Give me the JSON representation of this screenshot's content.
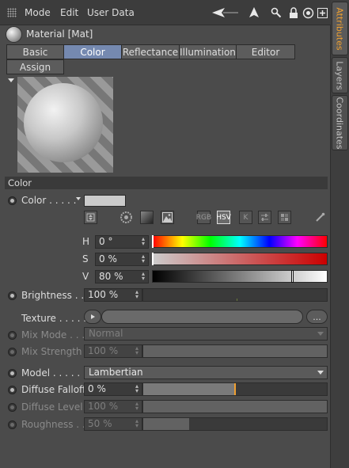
{
  "menu": {
    "mode": "Mode",
    "edit": "Edit",
    "user_data": "User Data"
  },
  "material": {
    "title": "Material [Mat]"
  },
  "tabs": {
    "basic": "Basic",
    "color": "Color",
    "reflectance": "Reflectance",
    "illumination": "Illumination",
    "editor": "Editor",
    "assign": "Assign"
  },
  "side_tabs": {
    "attributes": "Attributes",
    "layers": "Layers",
    "coordinates": "Coordinates"
  },
  "section": {
    "title": "Color"
  },
  "color": {
    "label": "Color . . . . .",
    "swatch_color": "#cbcbcb",
    "modes": {
      "rgb": "RGB",
      "hsv": "HSV",
      "k": "K"
    },
    "h": {
      "label": "H",
      "value": "0 °"
    },
    "s": {
      "label": "S",
      "value": "0 %"
    },
    "v": {
      "label": "V",
      "value": "80 %",
      "fraction": 0.8
    }
  },
  "brightness": {
    "label": "Brightness . . .",
    "value": "100 %"
  },
  "texture": {
    "label": "Texture . . . . .",
    "more": "..."
  },
  "mix_mode": {
    "label": "Mix Mode . . .",
    "value": "Normal"
  },
  "mix_strength": {
    "label": "Mix Strength",
    "value": "100 %",
    "fraction": 1.0
  },
  "model": {
    "label": "Model . . . . . . .",
    "value": "Lambertian"
  },
  "diffuse_falloff": {
    "label": "Diffuse Falloff",
    "value": "0 %",
    "fraction": 0.5,
    "accent": "#f0a030"
  },
  "diffuse_level": {
    "label": "Diffuse Level",
    "value": "100 %",
    "fraction": 1.0
  },
  "roughness": {
    "label": "Roughness . .",
    "value": "50 %",
    "fraction": 0.25
  }
}
